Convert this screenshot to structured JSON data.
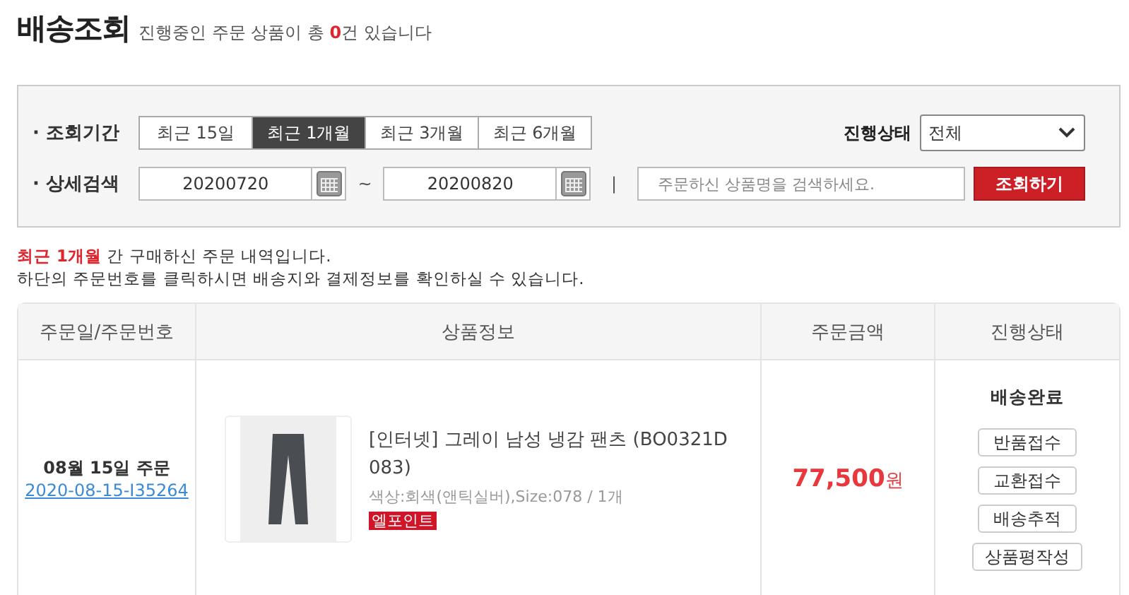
{
  "header": {
    "title": "배송조회",
    "summary": "진행중인 주문 상품이 총 **0**건 있습니다"
  },
  "filter": {
    "period_label": "· 조회기간",
    "periods": [
      {
        "label": "최근 15일",
        "selected": false
      },
      {
        "label": "최근 1개월",
        "selected": true
      },
      {
        "label": "최근 3개월",
        "selected": false
      },
      {
        "label": "최근 6개월",
        "selected": false
      }
    ],
    "status_label": "진행상태",
    "status_value": "전체",
    "detail_label": "· 상세검색",
    "date_from": "20200720",
    "date_separator": "~",
    "date_to": "20200820",
    "divider": "|",
    "search_placeholder": "주문하신 상품명을 검색하세요.",
    "search_button": "조회하기"
  },
  "notice": [
    "**최근 1개월** 간 구매하신 주문 내역입니다.",
    "하단의 주문번호를 클릭하시면 배송지와 결제정보를 확인하실 수 있습니다."
  ],
  "table": {
    "columns": [
      "주문일/주문번호",
      "상품정보",
      "주문금액",
      "진행상태"
    ],
    "rows": [
      {
        "date": "08월 15일 주문",
        "order_no": "2020-08-15-I35264",
        "product": "[인터넷] 그레이 남성 냉감 팬츠 (BO0321D083)",
        "option": "색상:회색(앤틱실버),Size:078 / 1개",
        "badge": "엘포인트",
        "price": "77,500",
        "currency": "원",
        "status": "배송완료",
        "actions": [
          "반품접수",
          "교환접수",
          "배송추적",
          "상품평작성"
        ]
      }
    ]
  }
}
